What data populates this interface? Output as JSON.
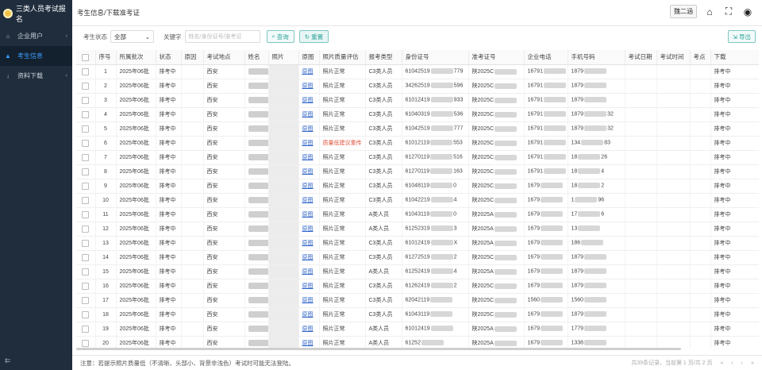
{
  "app": {
    "title": "三类人员考试报名"
  },
  "sidebar": {
    "items": [
      {
        "label": "企业用户",
        "icon": "home-icon",
        "chevron": "‹"
      },
      {
        "label": "考生信息",
        "icon": "user-icon",
        "active": true
      },
      {
        "label": "资料下载",
        "icon": "download-icon",
        "chevron": "‹"
      }
    ]
  },
  "header": {
    "breadcrumb": "考生信息/下载准考证",
    "user": "魏二涵"
  },
  "filters": {
    "status_label": "考生状态",
    "status_value": "全部",
    "keyword_label": "关键字",
    "keyword_placeholder": "姓名/身份证号/准考证",
    "query_label": "查询",
    "reset_label": "重置",
    "export_label": "导出"
  },
  "table": {
    "columns": [
      "序号",
      "所属批次",
      "状态",
      "原因",
      "考试地点",
      "姓名",
      "照片",
      "原图",
      "照片质量评估",
      "报考类型",
      "身份证号",
      "准考证号",
      "企业电话",
      "手机号码",
      "考试日期",
      "考试时间",
      "考点",
      "下载"
    ],
    "rows": [
      {
        "no": "1",
        "batch": "2025年06批",
        "status": "排考中",
        "site": "西安",
        "orig": "原图",
        "quality": "照片正常",
        "type": "C3类人员",
        "id_a": "61042519",
        "id_b": "779",
        "ticket": "陕2025C",
        "phone_a": "16791",
        "mobile_a": "1879",
        "mobile_b": "",
        "download": "排考中"
      },
      {
        "no": "2",
        "batch": "2025年06批",
        "status": "排考中",
        "site": "西安",
        "orig": "原图",
        "quality": "照片正常",
        "type": "C3类人员",
        "id_a": "34262519",
        "id_b": "596",
        "ticket": "陕2025C",
        "phone_a": "16791",
        "mobile_a": "1879",
        "mobile_b": "",
        "download": "排考中"
      },
      {
        "no": "3",
        "batch": "2025年06批",
        "status": "排考中",
        "site": "西安",
        "orig": "原图",
        "quality": "照片正常",
        "type": "C3类人员",
        "id_a": "61012419",
        "id_b": "933",
        "ticket": "陕2025C",
        "phone_a": "16791",
        "mobile_a": "1879",
        "mobile_b": "",
        "download": "排考中"
      },
      {
        "no": "4",
        "batch": "2025年06批",
        "status": "排考中",
        "site": "西安",
        "orig": "原图",
        "quality": "照片正常",
        "type": "C3类人员",
        "id_a": "61040319",
        "id_b": "536",
        "ticket": "陕2025C",
        "phone_a": "16791",
        "mobile_a": "1879",
        "mobile_b": "32",
        "download": "排考中"
      },
      {
        "no": "5",
        "batch": "2025年06批",
        "status": "排考中",
        "site": "西安",
        "orig": "原图",
        "quality": "照片正常",
        "type": "C3类人员",
        "id_a": "61042519",
        "id_b": "777",
        "ticket": "陕2025C",
        "phone_a": "16791",
        "mobile_a": "1879",
        "mobile_b": "32",
        "download": "排考中"
      },
      {
        "no": "6",
        "batch": "2025年06批",
        "status": "排考中",
        "site": "西安",
        "orig": "原图",
        "quality": "质量低建议重传",
        "warn": true,
        "type": "C3类人员",
        "id_a": "61012119",
        "id_b": "553",
        "ticket": "陕2025C",
        "phone_a": "16791",
        "mobile_a": "134",
        "mobile_b": "83",
        "download": "排考中"
      },
      {
        "no": "7",
        "batch": "2025年06批",
        "status": "排考中",
        "site": "西安",
        "orig": "原图",
        "quality": "照片正常",
        "type": "C3类人员",
        "id_a": "61270119",
        "id_b": "516",
        "ticket": "陕2025C",
        "phone_a": "16791",
        "mobile_a": "18",
        "mobile_b": "26",
        "download": "排考中"
      },
      {
        "no": "8",
        "batch": "2025年06批",
        "status": "排考中",
        "site": "西安",
        "orig": "原图",
        "quality": "照片正常",
        "type": "C3类人员",
        "id_a": "61270119",
        "id_b": "163",
        "ticket": "陕2025C",
        "phone_a": "16791",
        "mobile_a": "18",
        "mobile_b": "4",
        "download": "排考中"
      },
      {
        "no": "9",
        "batch": "2025年06批",
        "status": "排考中",
        "site": "西安",
        "orig": "原图",
        "quality": "照片正常",
        "type": "C3类人员",
        "id_a": "61048119",
        "id_b": "0",
        "ticket": "陕2025C",
        "phone_a": "1679",
        "mobile_a": "18",
        "mobile_b": "2",
        "download": "排考中"
      },
      {
        "no": "10",
        "batch": "2025年06批",
        "status": "排考中",
        "site": "西安",
        "orig": "原图",
        "quality": "照片正常",
        "type": "C3类人员",
        "id_a": "61042219",
        "id_b": "4",
        "ticket": "陕2025C",
        "phone_a": "1679",
        "mobile_a": "1",
        "mobile_b": "96",
        "download": "排考中"
      },
      {
        "no": "11",
        "batch": "2025年06批",
        "status": "排考中",
        "site": "西安",
        "orig": "原图",
        "quality": "照片正常",
        "type": "A类人员",
        "id_a": "61043119",
        "id_b": "0",
        "ticket": "陕2025A",
        "phone_a": "1679",
        "mobile_a": "17",
        "mobile_b": "6",
        "download": "排考中"
      },
      {
        "no": "12",
        "batch": "2025年06批",
        "status": "排考中",
        "site": "西安",
        "orig": "原图",
        "quality": "照片正常",
        "type": "A类人员",
        "id_a": "61252319",
        "id_b": "3",
        "ticket": "陕2025A",
        "phone_a": "1679",
        "mobile_a": "13",
        "mobile_b": "",
        "download": "排考中"
      },
      {
        "no": "13",
        "batch": "2025年06批",
        "status": "排考中",
        "site": "西安",
        "orig": "原图",
        "quality": "照片正常",
        "type": "C3类人员",
        "id_a": "61012419",
        "id_b": "X",
        "ticket": "陕2025A",
        "phone_a": "1679",
        "mobile_a": "186",
        "mobile_b": "",
        "download": "排考中"
      },
      {
        "no": "14",
        "batch": "2025年06批",
        "status": "排考中",
        "site": "西安",
        "orig": "原图",
        "quality": "照片正常",
        "type": "C3类人员",
        "id_a": "61272519",
        "id_b": "2",
        "ticket": "陕2025C",
        "phone_a": "1679",
        "mobile_a": "1879",
        "mobile_b": "",
        "download": "排考中"
      },
      {
        "no": "15",
        "batch": "2025年06批",
        "status": "排考中",
        "site": "西安",
        "orig": "原图",
        "quality": "照片正常",
        "type": "A类人员",
        "id_a": "61252419",
        "id_b": "4",
        "ticket": "陕2025A",
        "phone_a": "1679",
        "mobile_a": "1879",
        "mobile_b": "",
        "download": "排考中"
      },
      {
        "no": "16",
        "batch": "2025年06批",
        "status": "排考中",
        "site": "西安",
        "orig": "原图",
        "quality": "照片正常",
        "type": "C3类人员",
        "id_a": "61262419",
        "id_b": "2",
        "ticket": "陕2025C",
        "phone_a": "1679",
        "mobile_a": "1879",
        "mobile_b": "",
        "download": "排考中"
      },
      {
        "no": "17",
        "batch": "2025年06批",
        "status": "排考中",
        "site": "西安",
        "orig": "原图",
        "quality": "照片正常",
        "type": "C3类人员",
        "id_a": "62042119",
        "id_b": "",
        "ticket": "陕2025C",
        "phone_a": "1560",
        "mobile_a": "1560",
        "mobile_b": "",
        "download": "排考中"
      },
      {
        "no": "18",
        "batch": "2025年06批",
        "status": "排考中",
        "site": "西安",
        "orig": "原图",
        "quality": "照片正常",
        "type": "C3类人员",
        "id_a": "61043119",
        "id_b": "",
        "ticket": "陕2025C",
        "phone_a": "1679",
        "mobile_a": "1879",
        "mobile_b": "",
        "download": "排考中"
      },
      {
        "no": "19",
        "batch": "2025年06批",
        "status": "排考中",
        "site": "西安",
        "orig": "原图",
        "quality": "照片正常",
        "type": "A类人员",
        "id_a": "61012419",
        "id_b": "",
        "ticket": "陕2025A",
        "phone_a": "1679",
        "mobile_a": "1779",
        "mobile_b": "",
        "download": "排考中"
      },
      {
        "no": "20",
        "batch": "2025年06批",
        "status": "排考中",
        "site": "西安",
        "orig": "原图",
        "quality": "照片正常",
        "type": "A类人员",
        "id_a": "61252",
        "id_b": "",
        "ticket": "陕2025A",
        "phone_a": "1679",
        "mobile_a": "1338",
        "mobile_b": "",
        "download": "排考中"
      }
    ]
  },
  "footer": {
    "notice": "注意：若提示照片质量低（不清晰、头部小、背景非浅色）考试时可能无法登陆。",
    "total": "共39条记录，当前第 1 页/共 2 页",
    "first": "«",
    "prev": "‹",
    "next": "›",
    "last": "»"
  }
}
